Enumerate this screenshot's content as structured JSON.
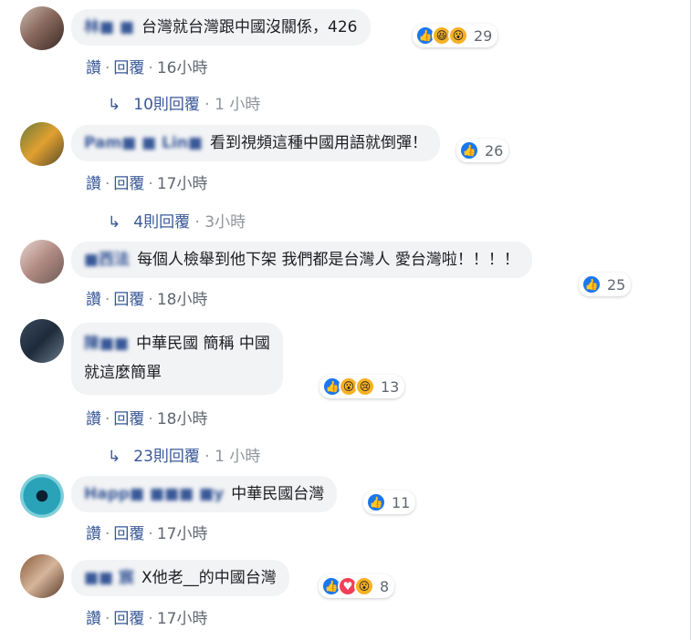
{
  "comments": [
    {
      "author": "林■ ■",
      "text": "台灣就台灣跟中國沒關係，426",
      "reactions": [
        "like",
        "haha",
        "wow"
      ],
      "reaction_count": "29",
      "actions": {
        "like": "讚",
        "reply": "回覆",
        "time": "16小時"
      },
      "replies": {
        "label": "10則回覆",
        "time": "1 小時"
      }
    },
    {
      "author": "Pam■ ■ Lin■",
      "text": "看到視頻這種中國用語就倒彈！",
      "reactions": [
        "like"
      ],
      "reaction_count": "26",
      "actions": {
        "like": "讚",
        "reply": "回覆",
        "time": "17小時"
      },
      "replies": {
        "label": "4則回覆",
        "time": "3小時"
      }
    },
    {
      "author": "■西法",
      "text": "每個人檢舉到他下架 我們都是台灣人 愛台灣啦！！！！",
      "reactions": [
        "like"
      ],
      "reaction_count": "25",
      "actions": {
        "like": "讚",
        "reply": "回覆",
        "time": "18小時"
      }
    },
    {
      "author": "陳■■",
      "text_line1": "中華民國 簡稱 中國",
      "text_line2": "就這麼簡單",
      "reactions": [
        "like",
        "wow",
        "sad"
      ],
      "reaction_count": "13",
      "actions": {
        "like": "讚",
        "reply": "回覆",
        "time": "18小時"
      },
      "replies": {
        "label": "23則回覆",
        "time": "1 小時"
      }
    },
    {
      "author": "Happ■ ■■■ ■y",
      "text": "中華民國台灣",
      "reactions": [
        "like"
      ],
      "reaction_count": "11",
      "actions": {
        "like": "讚",
        "reply": "回覆",
        "time": "17小時"
      }
    },
    {
      "author": "■■ 宸",
      "text": "X他老__的中國台灣",
      "reactions": [
        "like",
        "love",
        "wow"
      ],
      "reaction_count": "8",
      "actions": {
        "like": "讚",
        "reply": "回覆",
        "time": "17小時"
      }
    }
  ],
  "colors": {
    "link": "#385898",
    "bubble": "#f2f3f5",
    "like": "#1877f2"
  }
}
